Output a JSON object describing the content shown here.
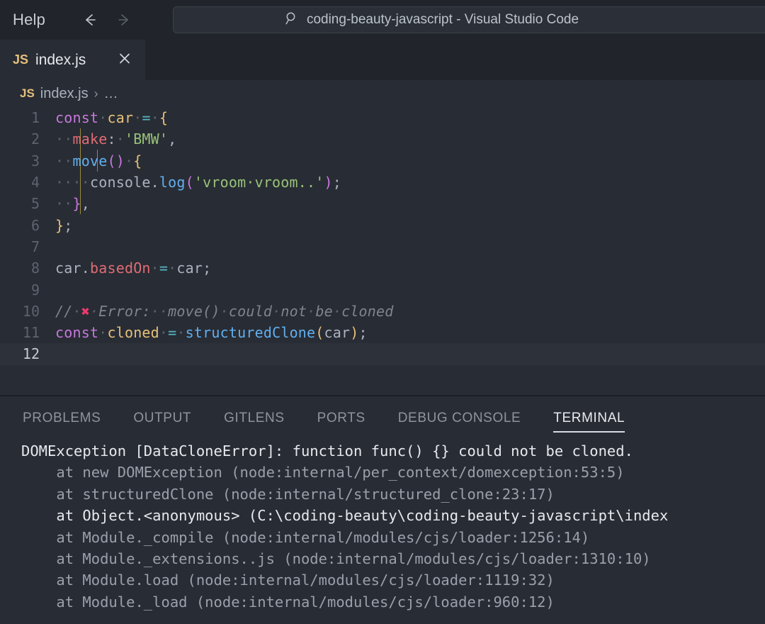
{
  "window": {
    "menu_label": "Help",
    "back_icon": "arrow-left-icon",
    "forward_icon": "arrow-right-icon",
    "search_icon": "search-icon",
    "title": "coding-beauty-javascript - Visual Studio Code"
  },
  "tabs": {
    "items": [
      {
        "icon_label": "JS",
        "name": "index.js",
        "close_label": "×",
        "active": true
      }
    ]
  },
  "breadcrumb": {
    "icon_label": "JS",
    "file": "index.js",
    "separator": "›",
    "ellipsis": "…"
  },
  "editor": {
    "language": "javascript",
    "active_line": 12,
    "lines": [
      {
        "n": "1",
        "text": "const car = {"
      },
      {
        "n": "2",
        "text": "  make: 'BMW',"
      },
      {
        "n": "3",
        "text": "  move() {"
      },
      {
        "n": "4",
        "text": "    console.log('vroom vroom..');"
      },
      {
        "n": "5",
        "text": "  },"
      },
      {
        "n": "6",
        "text": "};"
      },
      {
        "n": "7",
        "text": ""
      },
      {
        "n": "8",
        "text": "car.basedOn = car;"
      },
      {
        "n": "9",
        "text": ""
      },
      {
        "n": "10",
        "text": "// ❌ Error: move() could not be cloned"
      },
      {
        "n": "11",
        "text": "const cloned = structuredClone(car);"
      },
      {
        "n": "12",
        "text": ""
      }
    ]
  },
  "panel": {
    "tabs": [
      {
        "label": "PROBLEMS",
        "active": false
      },
      {
        "label": "OUTPUT",
        "active": false
      },
      {
        "label": "GITLENS",
        "active": false
      },
      {
        "label": "PORTS",
        "active": false
      },
      {
        "label": "DEBUG CONSOLE",
        "active": false
      },
      {
        "label": "TERMINAL",
        "active": true
      }
    ],
    "terminal": {
      "lines": [
        "DOMException [DataCloneError]: function func() {} could not be cloned.",
        "    at new DOMException (node:internal/per_context/domexception:53:5)",
        "    at structuredClone (node:internal/structured_clone:23:17)",
        "    at Object.<anonymous> (C:\\coding-beauty\\coding-beauty-javascript\\index",
        "    at Module._compile (node:internal/modules/cjs/loader:1256:14)",
        "    at Module._extensions..js (node:internal/modules/cjs/loader:1310:10)",
        "    at Module.load (node:internal/modules/cjs/loader:1119:32)",
        "    at Module._load (node:internal/modules/cjs/loader:960:12)"
      ]
    }
  },
  "colors": {
    "titlebar_bg": "#21252b",
    "editor_bg": "#282c34",
    "active_line_bg": "#2c313a",
    "keyword": "#c678dd",
    "variable": "#e5c07b",
    "string": "#98c379",
    "function": "#61afef",
    "property": "#e06c75",
    "comment": "#7f848e",
    "operator": "#56b6c2",
    "accent": "#d7dae0"
  }
}
